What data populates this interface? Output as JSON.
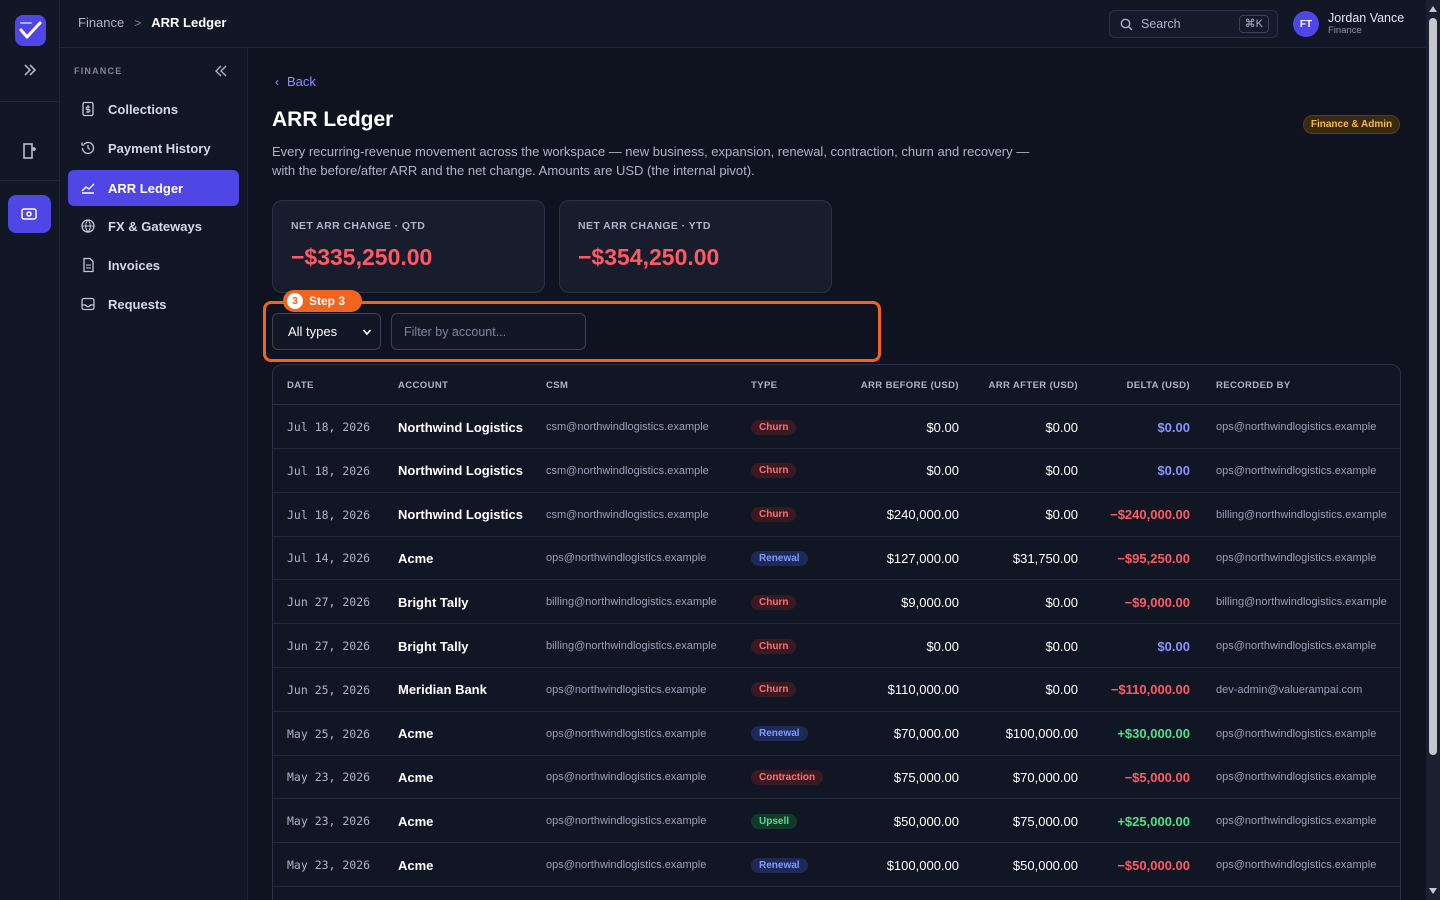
{
  "topbar": {
    "breadcrumb_parent": "Finance",
    "breadcrumb_sep": ">",
    "breadcrumb_current": "ARR Ledger",
    "search_label": "Search",
    "search_shortcut": "⌘K",
    "user_initials": "FT",
    "user_name": "Jordan Vance",
    "user_role": "Finance"
  },
  "sidebar": {
    "section_label": "FINANCE",
    "items": [
      {
        "label": "Collections",
        "icon": "dollar-doc-icon"
      },
      {
        "label": "Payment History",
        "icon": "history-icon"
      },
      {
        "label": "ARR Ledger",
        "icon": "chart-line-icon"
      },
      {
        "label": "FX & Gateways",
        "icon": "globe-icon"
      },
      {
        "label": "Invoices",
        "icon": "document-icon"
      },
      {
        "label": "Requests",
        "icon": "inbox-icon"
      }
    ],
    "active_index": 2
  },
  "page": {
    "back_label": "Back",
    "title": "ARR Ledger",
    "role_badge": "Finance & Admin",
    "description": "Every recurring-revenue movement across the workspace — new business, expansion, renewal, contraction, churn and recovery — with the before/after ARR and the net change. Amounts are USD (the internal pivot)."
  },
  "kpis": [
    {
      "label": "NET ARR CHANGE · QTD",
      "value": "−$335,250.00"
    },
    {
      "label": "NET ARR CHANGE · YTD",
      "value": "−$354,250.00"
    }
  ],
  "filters": {
    "step_number": "3",
    "step_label": "Step 3",
    "type_selected": "All types",
    "account_placeholder": "Filter by account..."
  },
  "table": {
    "columns": [
      "DATE",
      "ACCOUNT",
      "CSM",
      "TYPE",
      "ARR BEFORE (USD)",
      "ARR AFTER (USD)",
      "DELTA (USD)",
      "RECORDED BY"
    ],
    "rows": [
      {
        "date": "Jul 18, 2026",
        "account": "Northwind Logistics",
        "csm": "csm@northwindlogistics.example",
        "type": "Churn",
        "before": "$0.00",
        "after": "$0.00",
        "delta": "$0.00",
        "delta_sign": "zero",
        "recorded_by": "ops@northwindlogistics.example"
      },
      {
        "date": "Jul 18, 2026",
        "account": "Northwind Logistics",
        "csm": "csm@northwindlogistics.example",
        "type": "Churn",
        "before": "$0.00",
        "after": "$0.00",
        "delta": "$0.00",
        "delta_sign": "zero",
        "recorded_by": "ops@northwindlogistics.example"
      },
      {
        "date": "Jul 18, 2026",
        "account": "Northwind Logistics",
        "csm": "csm@northwindlogistics.example",
        "type": "Churn",
        "before": "$240,000.00",
        "after": "$0.00",
        "delta": "−$240,000.00",
        "delta_sign": "neg",
        "recorded_by": "billing@northwindlogistics.example"
      },
      {
        "date": "Jul 14, 2026",
        "account": "Acme",
        "csm": "ops@northwindlogistics.example",
        "type": "Renewal",
        "before": "$127,000.00",
        "after": "$31,750.00",
        "delta": "−$95,250.00",
        "delta_sign": "neg",
        "recorded_by": "ops@northwindlogistics.example"
      },
      {
        "date": "Jun 27, 2026",
        "account": "Bright Tally",
        "csm": "billing@northwindlogistics.example",
        "type": "Churn",
        "before": "$9,000.00",
        "after": "$0.00",
        "delta": "−$9,000.00",
        "delta_sign": "neg",
        "recorded_by": "billing@northwindlogistics.example"
      },
      {
        "date": "Jun 27, 2026",
        "account": "Bright Tally",
        "csm": "billing@northwindlogistics.example",
        "type": "Churn",
        "before": "$0.00",
        "after": "$0.00",
        "delta": "$0.00",
        "delta_sign": "zero",
        "recorded_by": "ops@northwindlogistics.example"
      },
      {
        "date": "Jun 25, 2026",
        "account": "Meridian Bank",
        "csm": "ops@northwindlogistics.example",
        "type": "Churn",
        "before": "$110,000.00",
        "after": "$0.00",
        "delta": "−$110,000.00",
        "delta_sign": "neg",
        "recorded_by": "dev-admin@valuerampai.com"
      },
      {
        "date": "May 25, 2026",
        "account": "Acme",
        "csm": "ops@northwindlogistics.example",
        "type": "Renewal",
        "before": "$70,000.00",
        "after": "$100,000.00",
        "delta": "+$30,000.00",
        "delta_sign": "pos",
        "recorded_by": "ops@northwindlogistics.example"
      },
      {
        "date": "May 23, 2026",
        "account": "Acme",
        "csm": "ops@northwindlogistics.example",
        "type": "Contraction",
        "before": "$75,000.00",
        "after": "$70,000.00",
        "delta": "−$5,000.00",
        "delta_sign": "neg",
        "recorded_by": "ops@northwindlogistics.example"
      },
      {
        "date": "May 23, 2026",
        "account": "Acme",
        "csm": "ops@northwindlogistics.example",
        "type": "Upsell",
        "before": "$50,000.00",
        "after": "$75,000.00",
        "delta": "+$25,000.00",
        "delta_sign": "pos",
        "recorded_by": "ops@northwindlogistics.example"
      },
      {
        "date": "May 23, 2026",
        "account": "Acme",
        "csm": "ops@northwindlogistics.example",
        "type": "Renewal",
        "before": "$100,000.00",
        "after": "$50,000.00",
        "delta": "−$50,000.00",
        "delta_sign": "neg",
        "recorded_by": "ops@northwindlogistics.example"
      }
    ]
  },
  "colors": {
    "accent": "#4f46e5",
    "negative": "#ff5a64",
    "positive": "#4ee08a",
    "highlight": "#f1641e",
    "badge_amber": "#f5b94a"
  }
}
